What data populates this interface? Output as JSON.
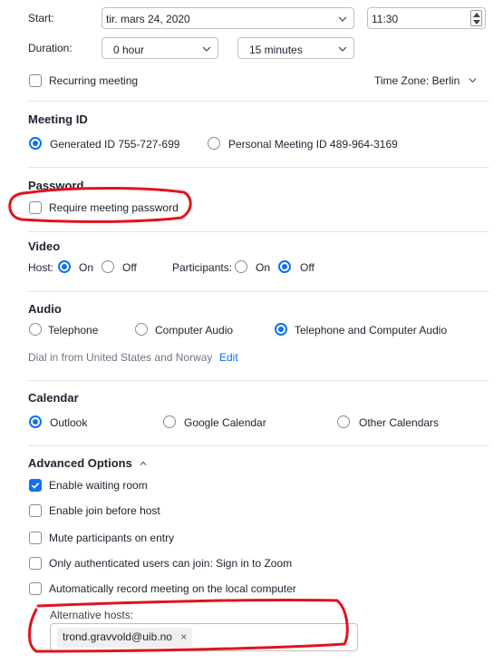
{
  "start": {
    "label": "Start:",
    "date_value": "tir.  mars 24, 2020",
    "time_value": "11:30"
  },
  "duration": {
    "label": "Duration:",
    "hours_value": "0 hour",
    "minutes_value": "15 minutes"
  },
  "recurring": {
    "label": "Recurring meeting",
    "checked": false
  },
  "timezone": {
    "label": "Time Zone: Berlin"
  },
  "meeting_id": {
    "title": "Meeting ID",
    "generated_label": "Generated ID 755-727-699",
    "personal_label": "Personal Meeting ID 489-964-3169",
    "selected": "generated"
  },
  "password": {
    "title": "Password",
    "require_label": "Require meeting password",
    "checked": false
  },
  "video": {
    "title": "Video",
    "host_label": "Host:",
    "participants_label": "Participants:",
    "on_label": "On",
    "off_label": "Off",
    "host": "on",
    "participants": "off"
  },
  "audio": {
    "title": "Audio",
    "telephone_label": "Telephone",
    "computer_label": "Computer Audio",
    "both_label": "Telephone and Computer Audio",
    "selected": "both",
    "dial_in_text": "Dial in from United States and Norway",
    "edit_label": "Edit"
  },
  "calendar": {
    "title": "Calendar",
    "outlook_label": "Outlook",
    "google_label": "Google Calendar",
    "other_label": "Other Calendars",
    "selected": "outlook"
  },
  "advanced": {
    "title": "Advanced Options",
    "options": [
      {
        "label": "Enable waiting room",
        "checked": true
      },
      {
        "label": "Enable join before host",
        "checked": false
      },
      {
        "label": "Mute participants on entry",
        "checked": false
      },
      {
        "label": "Only authenticated users can join: Sign in to Zoom",
        "checked": false
      },
      {
        "label": "Automatically record meeting on the local computer",
        "checked": false
      }
    ],
    "alt_hosts_label": "Alternative hosts:",
    "alt_host_chip": "trond.gravvold@uib.no",
    "chip_remove": "×"
  },
  "colors": {
    "accent": "#0e71eb",
    "annotation": "#e0141e"
  }
}
